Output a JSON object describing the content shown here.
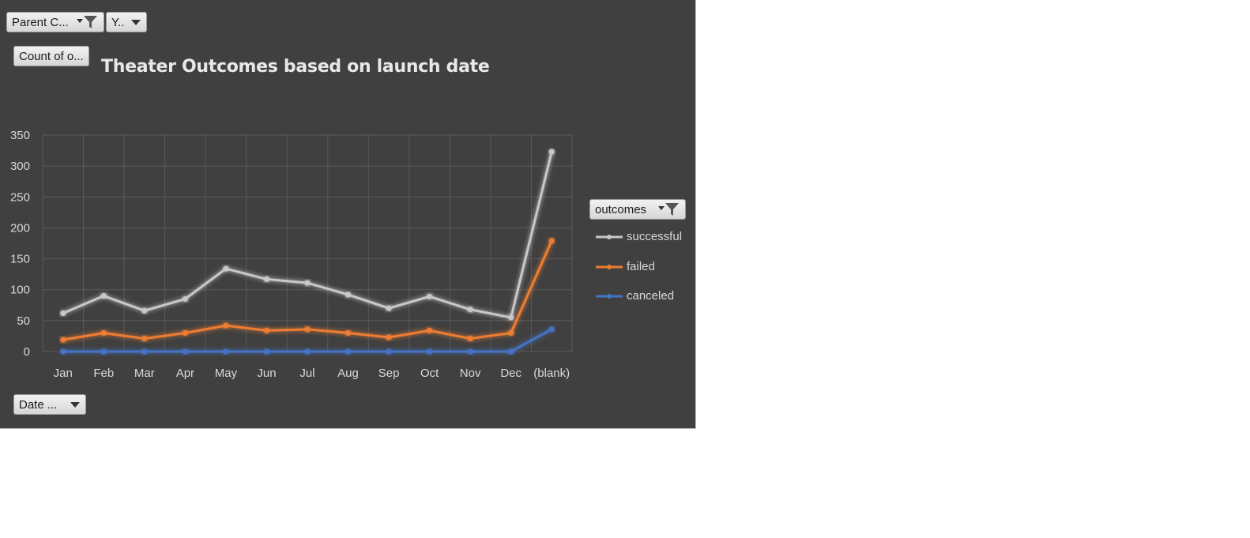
{
  "filters": {
    "parent_category": "Parent C...",
    "years": "Y..",
    "values_field": "Count of o...",
    "axis_field": "Date ...",
    "legend_field": "outcomes"
  },
  "icons": {
    "filter": "filter-dropdown-icon",
    "dropdown": "chevron-down-icon"
  },
  "colors": {
    "background": "#404040",
    "successful": "#c8c8c8",
    "failed": "#ed7d31",
    "canceled": "#4472c4",
    "text": "#d9d9d9"
  },
  "chart_data": {
    "type": "line",
    "title": "Theater Outcomes based on launch date",
    "categories": [
      "Jan",
      "Feb",
      "Mar",
      "Apr",
      "May",
      "Jun",
      "Jul",
      "Aug",
      "Sep",
      "Oct",
      "Nov",
      "Dec",
      "(blank)"
    ],
    "series": [
      {
        "name": "successful",
        "values": [
          62,
          90,
          66,
          85,
          134,
          117,
          111,
          92,
          70,
          89,
          68,
          55,
          323
        ]
      },
      {
        "name": "failed",
        "values": [
          19,
          30,
          21,
          30,
          42,
          34,
          36,
          30,
          23,
          34,
          21,
          30,
          179
        ]
      },
      {
        "name": "canceled",
        "values": [
          0,
          0,
          0,
          0,
          0,
          0,
          0,
          0,
          0,
          0,
          0,
          0,
          36
        ]
      }
    ],
    "ylim": [
      0,
      350
    ],
    "yticks": [
      0,
      50,
      100,
      150,
      200,
      250,
      300,
      350
    ],
    "grid": true,
    "legend": "right"
  }
}
